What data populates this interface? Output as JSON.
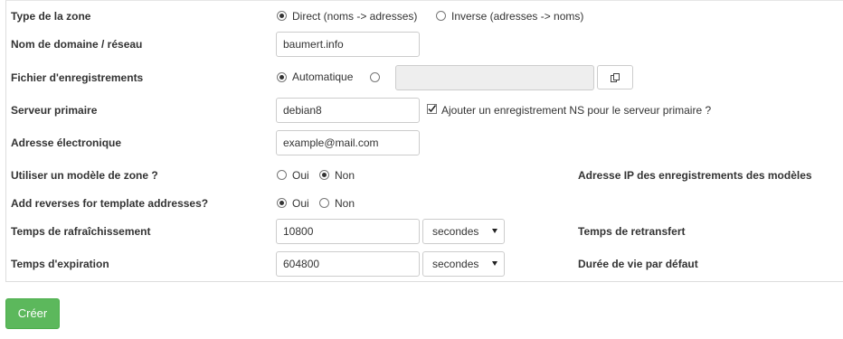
{
  "form": {
    "zone_type": {
      "label": "Type de la zone",
      "options": [
        "Direct (noms -> adresses)",
        "Inverse (adresses -> noms)"
      ],
      "selected": "Direct (noms -> adresses)"
    },
    "domain": {
      "label": "Nom de domaine / réseau",
      "value": "baumert.info"
    },
    "records_file": {
      "label": "Fichier d'enregistrements",
      "auto_label": "Automatique",
      "selected": "Automatique",
      "path_value": ""
    },
    "primary_server": {
      "label": "Serveur primaire",
      "value": "debian8",
      "add_ns_label": "Ajouter un enregistrement NS pour le serveur primaire ?",
      "add_ns_checked": true
    },
    "email": {
      "label": "Adresse électronique",
      "value": "example@mail.com"
    },
    "use_template": {
      "label": "Utiliser un modèle de zone ?",
      "yes": "Oui",
      "no": "Non",
      "selected": "Non"
    },
    "template_ip": {
      "label": "Adresse IP des enregistrements des modèles"
    },
    "reverse_template": {
      "label": "Add reverses for template addresses?",
      "yes": "Oui",
      "no": "Non",
      "selected": "Oui"
    },
    "refresh": {
      "label": "Temps de rafraîchissement",
      "value": "10800",
      "unit": "secondes"
    },
    "retransfer": {
      "label": "Temps de retransfert"
    },
    "expire": {
      "label": "Temps d'expiration",
      "value": "604800",
      "unit": "secondes"
    },
    "default_ttl": {
      "label": "Durée de vie par défaut"
    }
  },
  "actions": {
    "create_label": "Créer"
  },
  "colors": {
    "create_button": "#5cb85c",
    "border": "#dddddd",
    "disabled_input": "#eeeeee"
  },
  "icons": {
    "file_chooser": "file-chooser-icon",
    "checkbox": "checkmark-icon"
  }
}
